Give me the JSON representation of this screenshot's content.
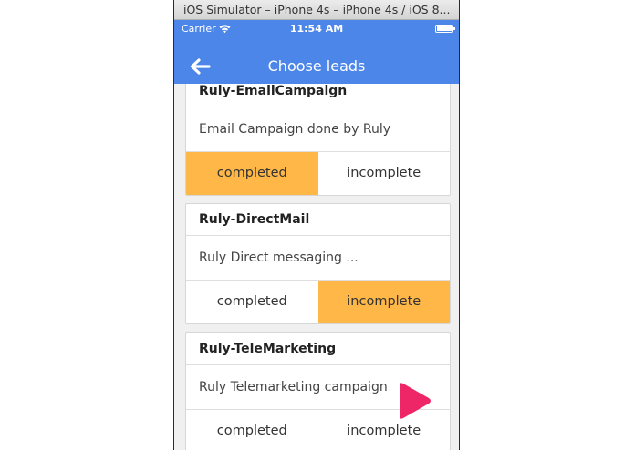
{
  "simulator": {
    "title": "iOS Simulator – iPhone 4s – iPhone 4s / iOS 8..."
  },
  "status_bar": {
    "carrier": "Carrier",
    "time": "11:54 AM",
    "wifi_icon": "wifi-icon",
    "battery_icon": "battery-icon"
  },
  "navbar": {
    "title": "Choose leads",
    "back_icon": "arrow-left-icon",
    "color": "#4c86e8"
  },
  "colors": {
    "accent": "#ffb748",
    "nav": "#4c86e8"
  },
  "leads": [
    {
      "name": "Ruly-EmailCampaign",
      "description": "Email Campaign done by Ruly",
      "completed_label": "completed",
      "incomplete_label": "incomplete",
      "selected": "completed"
    },
    {
      "name": "Ruly-DirectMail",
      "description": "Ruly Direct messaging ...",
      "completed_label": "completed",
      "incomplete_label": "incomplete",
      "selected": "incomplete"
    },
    {
      "name": "Ruly-TeleMarketing",
      "description": "Ruly Telemarketing campaign",
      "completed_label": "completed",
      "incomplete_label": "incomplete",
      "selected": "none"
    }
  ],
  "overlay": {
    "icon": "play-icon",
    "color": "#ee2566"
  }
}
